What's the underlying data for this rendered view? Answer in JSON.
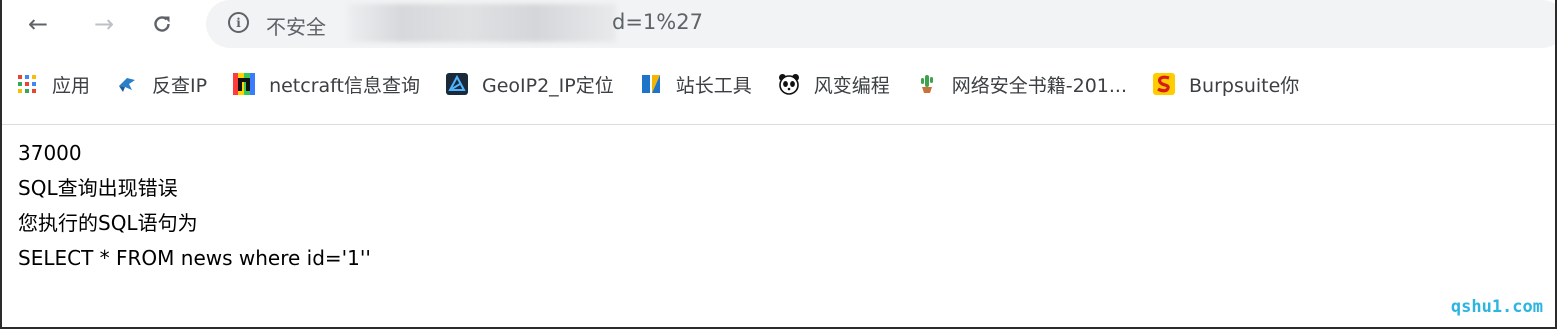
{
  "toolbar": {
    "back_icon": "arrow-left",
    "forward_icon": "arrow-right",
    "reload_icon": "reload",
    "security_label": "不安全",
    "url_visible": "d=1%27"
  },
  "bookmarks": [
    {
      "label": "应用",
      "icon": "apps-grid-icon"
    },
    {
      "label": "反查IP",
      "icon": "bird-icon"
    },
    {
      "label": "netcraft信息查询",
      "icon": "netcraft-icon"
    },
    {
      "label": "GeoIP2_IP定位",
      "icon": "geoip-icon"
    },
    {
      "label": "站长工具",
      "icon": "chinaz-icon"
    },
    {
      "label": "风变编程",
      "icon": "panda-icon"
    },
    {
      "label": "网络安全书籍-201...",
      "icon": "cactus-icon"
    },
    {
      "label": "Burpsuite你",
      "icon": "burp-icon"
    }
  ],
  "content": {
    "line1": "37000",
    "line2": "SQL查询出现错误",
    "line3": "您执行的SQL语句为",
    "line4": "SELECT * FROM news where id='1''"
  },
  "watermark": "qshu1.com",
  "colors": {
    "omnibox_bg": "#f1f3f4",
    "watermark": "#2bb5e0",
    "border": "#2b2b2b"
  }
}
